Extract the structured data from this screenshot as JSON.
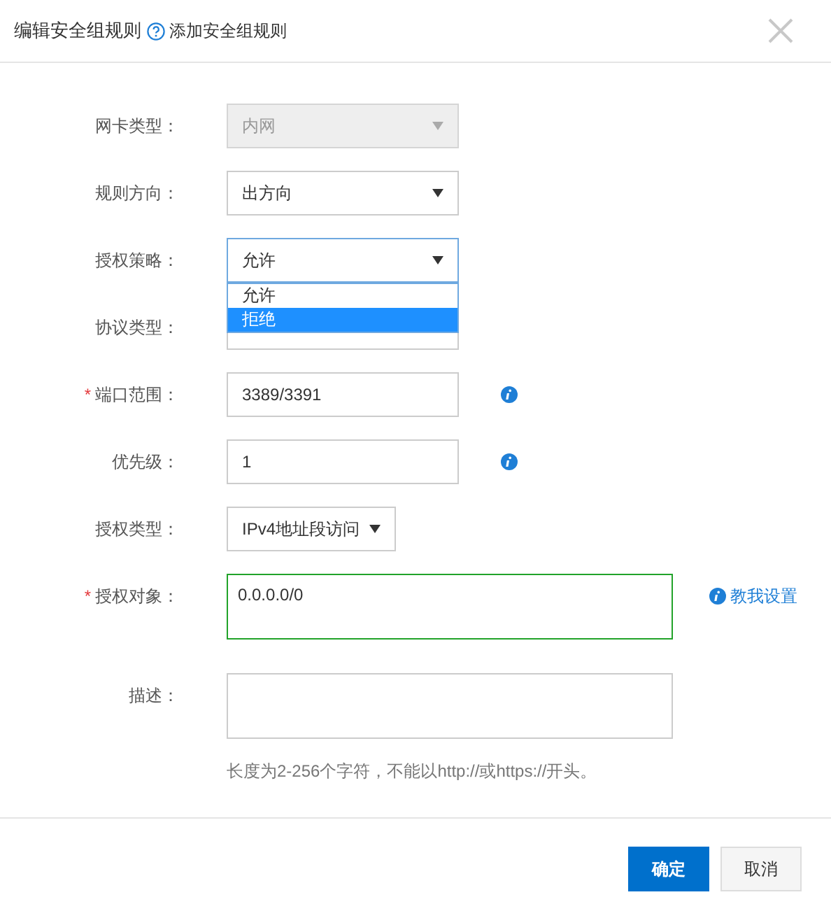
{
  "dialog": {
    "title": "编辑安全组规则",
    "help_link": "添加安全组规则"
  },
  "fields": [
    {
      "kind": "select",
      "label": "网卡类型：",
      "value": "内网",
      "disabled": true,
      "open": false
    },
    {
      "kind": "select",
      "label": "规则方向：",
      "value": "出方向",
      "disabled": false,
      "open": false
    },
    {
      "kind": "select",
      "label": "授权策略：",
      "value": "允许",
      "disabled": false,
      "open": true,
      "options": [
        {
          "label": "允许",
          "highlighted": false
        },
        {
          "label": "拒绝",
          "highlighted": true
        }
      ]
    },
    {
      "kind": "input",
      "label": "协议类型："
    },
    {
      "kind": "input",
      "label": "端口范围：",
      "required_mark": "*",
      "value": "3389/3391",
      "info": true
    },
    {
      "kind": "input",
      "label": "优先级：",
      "value": "1",
      "info": true
    },
    {
      "kind": "select_narrow",
      "label": "授权类型：",
      "value": "IPv4地址段访问",
      "disabled": false,
      "open": false
    },
    {
      "kind": "textarea",
      "label": "授权对象：",
      "required_mark": "*",
      "value": "0.0.0.0/0",
      "valid": true,
      "link": "教我设置"
    },
    {
      "kind": "textarea",
      "label": "描述：",
      "hint": "长度为2-256个字符，不能以http://或https://开头。"
    }
  ],
  "buttons": [
    {
      "label": "确定",
      "primary": true
    },
    {
      "label": "取消",
      "primary": false
    }
  ]
}
